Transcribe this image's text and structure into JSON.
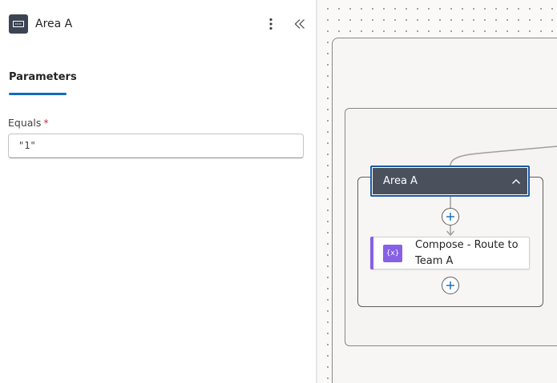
{
  "panel": {
    "title": "Area A",
    "icon": "switch-case-icon",
    "tab_parameters": "Parameters"
  },
  "form": {
    "equals_label": "Equals",
    "required_mark": "*",
    "equals_value": "\"1\""
  },
  "canvas": {
    "case_title": "Area A",
    "action": {
      "title": "Compose - Route to Team A",
      "icon_glyph": "{x}",
      "icon": "compose-icon"
    }
  },
  "colors": {
    "accent": "#0f6cbd",
    "compose": "#8661e5",
    "case_header": "#4a515c",
    "required": "#c4314b"
  }
}
